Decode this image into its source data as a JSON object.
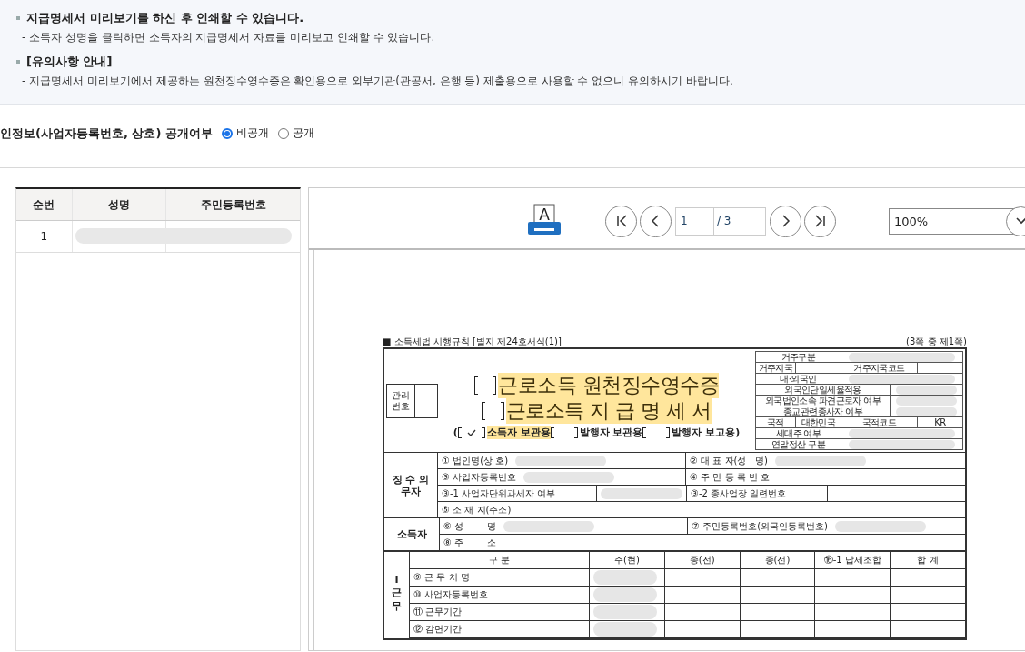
{
  "notice": [
    {
      "title": "지급명세서 미리보기를 하신 후 인쇄할 수 있습니다.",
      "detail": "- 소득자 성명을 클릭하면 소득자의 지급명세서 자료를 미리보고 인쇄할 수 있습니다."
    },
    {
      "title": "[유의사항 안내]",
      "detail": "- 지급명세서 미리보기에서 제공하는 원천징수영수증은 확인용으로 외부기관(관공서, 은행 등) 제출용으로 사용할 수 없으니 유의하시기 바랍니다."
    }
  ],
  "privacy": {
    "label": "인정보(사업자등록번호, 상호) 공개여부",
    "options": [
      {
        "label": "비공개",
        "selected": true
      },
      {
        "label": "공개",
        "selected": false
      }
    ]
  },
  "earners": {
    "columns": [
      "순번",
      "성명",
      "주민등록번호"
    ],
    "rows": [
      {
        "number": "1",
        "redacted": true
      }
    ]
  },
  "viewer": {
    "print_icon_letter": "A",
    "page": "1",
    "total": "/ 3",
    "zoom": "100%"
  },
  "form": {
    "header_left": "■ 소득세법 시행규칙 [별지 제24호서식(1)]",
    "header_right": "(3쪽 중 제1쪽)",
    "management_label": "관리 번호",
    "titles": [
      {
        "text": "근로소득 원천징수영수증",
        "checked": false,
        "highlighted": true
      },
      {
        "text": "근로소득 지 급 명 세 서",
        "checked": false,
        "highlighted": true
      }
    ],
    "copies_open": "(",
    "copies_close": ")",
    "copies": [
      {
        "label": "소득자 보관용",
        "checked": true,
        "highlighted": true
      },
      {
        "label": "발행자 보관용",
        "checked": false,
        "highlighted": false
      },
      {
        "label": "발행자 보고용",
        "checked": false,
        "highlighted": false
      }
    ],
    "residence": [
      {
        "kind": "wide",
        "label": "거주구분",
        "redacted": true
      },
      {
        "kind": "pair",
        "label": "거주지국",
        "label2": "거주지국코드"
      },
      {
        "kind": "wide",
        "label": "내·외국인",
        "redacted": true
      },
      {
        "kind": "long",
        "label": "외국인단일세율적용",
        "redacted": true
      },
      {
        "kind": "long",
        "label": "외국법인소속 파견근로자 여부",
        "redacted": true
      },
      {
        "kind": "long",
        "label": "종교관련종사자 여부",
        "redacted": true
      },
      {
        "kind": "pair",
        "label": "국적",
        "value": "대한민국",
        "label2": "국적코드",
        "value2": "KR"
      },
      {
        "kind": "wide",
        "label": "세대주 여부",
        "redacted": true
      },
      {
        "kind": "wide",
        "label": "연말정산 구분",
        "redacted": true
      }
    ],
    "sections": [
      {
        "label": "징 수 의무자",
        "rows": [
          {
            "kind": "halves",
            "cells": [
              {
                "label": "① 법인명(상 호)",
                "redacted": true
              },
              {
                "label": "② 대 표 자(성   명)",
                "redacted": true
              }
            ]
          },
          {
            "kind": "halves",
            "cells": [
              {
                "label": "③ 사업자등록번호",
                "redacted": true
              },
              {
                "label": "④ 주 민 등 록 번 호"
              }
            ]
          },
          {
            "kind": "split",
            "cells": [
              {
                "label": "③-1 사업자단위과세자 여부",
                "redacted": true
              },
              {
                "label": "③-2 종사업장 일련번호"
              }
            ]
          },
          {
            "kind": "full",
            "cells": [
              {
                "label": "⑤ 소 재 지(주소)"
              }
            ]
          }
        ]
      },
      {
        "label": "소득자",
        "rows": [
          {
            "kind": "halves",
            "cells": [
              {
                "label": "⑥ 성        명",
                "redacted": true
              },
              {
                "label": "⑦ 주민등록번호(외국인등록번호)",
                "redacted": true
              }
            ]
          },
          {
            "kind": "full",
            "cells": [
              {
                "label": "⑧ 주        소"
              }
            ]
          }
        ]
      }
    ],
    "income": {
      "label": "I근무",
      "columns": [
        "구 분",
        "주(현)",
        "종(전)",
        "종(전)",
        "⑯-1 납세조합",
        "합 계"
      ],
      "rows": [
        {
          "label": "⑨ 근 무 처 명",
          "redacted": true
        },
        {
          "label": "⑩ 사업자등록번호",
          "redacted": true
        },
        {
          "label": "⑪ 근무기간",
          "redacted": true
        },
        {
          "label": "⑫ 감면기간",
          "redacted": true
        }
      ]
    }
  }
}
